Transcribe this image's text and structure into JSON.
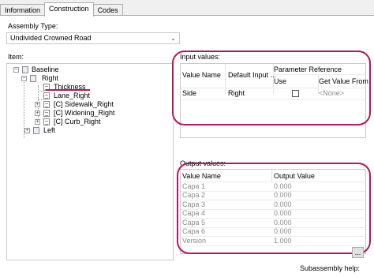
{
  "tabs": [
    {
      "label": "Information"
    },
    {
      "label": "Construction"
    },
    {
      "label": "Codes"
    }
  ],
  "assembly_type": {
    "label": "Assembly Type:",
    "value": "Undivided Crowned Road"
  },
  "item_label": "Item:",
  "tree": {
    "baseline": "Baseline",
    "right": "Right",
    "thickness": "Thickness",
    "lane_right": "Lane_Right",
    "sidewalk_right": "[C] Sidewalk_Right",
    "widening_right": "[C] Widening_Right",
    "curb_right": "[C] Curb_Right",
    "left": "Left"
  },
  "input_values": {
    "label": "Input values:",
    "col_value_name": "Value Name",
    "col_default_input": "Default Input ...",
    "col_param_ref": "Parameter Reference",
    "col_use": "Use",
    "col_get_value_from": "Get Value From",
    "rows": [
      {
        "name": "Side",
        "default": "Right",
        "use": false,
        "get_from": "<None>"
      }
    ]
  },
  "output_values": {
    "label": "Output values:",
    "col_value_name": "Value Name",
    "col_output_value": "Output Value",
    "rows": [
      {
        "name": "Capa 1",
        "value": "0.000"
      },
      {
        "name": "Capa 2",
        "value": "0.000"
      },
      {
        "name": "Capa 3",
        "value": "0.000"
      },
      {
        "name": "Capa 4",
        "value": "0.000"
      },
      {
        "name": "Capa 5",
        "value": "0.000"
      },
      {
        "name": "Capa 6",
        "value": "0.000"
      },
      {
        "name": "Version",
        "value": "1.000"
      }
    ]
  },
  "subassembly_help": {
    "label": "Subassembly help:",
    "button": "..."
  },
  "colors": {
    "annotation": "#b0185f",
    "border": "#adadad"
  }
}
